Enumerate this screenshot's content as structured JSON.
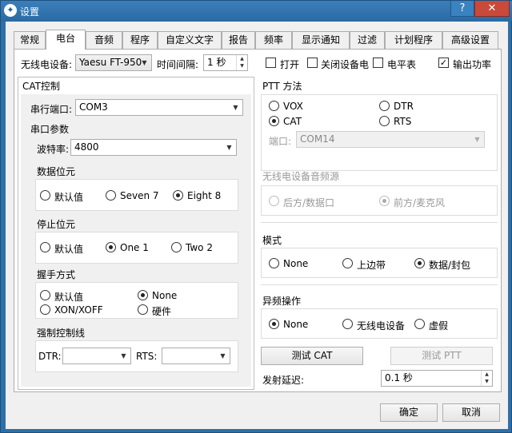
{
  "window": {
    "title": "设置",
    "help": "?",
    "close": "✕"
  },
  "tabs": [
    {
      "label": "常规"
    },
    {
      "label": "电台"
    },
    {
      "label": "音频"
    },
    {
      "label": "程序"
    },
    {
      "label": "自定义文字"
    },
    {
      "label": "报告"
    },
    {
      "label": "频率"
    },
    {
      "label": "显示通知"
    },
    {
      "label": "过滤"
    },
    {
      "label": "计划程序"
    },
    {
      "label": "高级设置"
    }
  ],
  "top": {
    "radio_label": "无线电设备:",
    "radio_value": "Yaesu FT-950",
    "interval_label": "时间间隔:",
    "interval_value": "1 秒",
    "open_label": "打开",
    "close_device_label": "关闭设备电",
    "meter_label": "电平表",
    "output_power_label": "输出功率",
    "output_power_checked": "✓"
  },
  "cat": {
    "title": "CAT控制",
    "port_label": "串行端口:",
    "port_value": "COM3",
    "serial_params": "串口参数",
    "baud_label": "波特率:",
    "baud_value": "4800",
    "databits_title": "数据位元",
    "databits": [
      "默认值",
      "Seven 7",
      "Eight 8"
    ],
    "stopbits_title": "停止位元",
    "stopbits": [
      "默认值",
      "One 1",
      "Two 2"
    ],
    "handshake_title": "握手方式",
    "handshake": [
      "默认值",
      "None",
      "XON/XOFF",
      "硬件"
    ],
    "force_title": "强制控制线",
    "dtr_label": "DTR:",
    "rts_label": "RTS:"
  },
  "ptt": {
    "title": "PTT 方法",
    "options": [
      "VOX",
      "DTR",
      "CAT",
      "RTS"
    ],
    "port_label": "端口:",
    "port_value": "COM14"
  },
  "audio_src": {
    "title": "无线电设备音频源",
    "options": [
      "后方/数据口",
      "前方/麦克风"
    ]
  },
  "mode": {
    "title": "模式",
    "options": [
      "None",
      "上边带",
      "数据/封包"
    ]
  },
  "split": {
    "title": "异频操作",
    "options": [
      "None",
      "无线电设备",
      "虚假"
    ]
  },
  "buttons": {
    "test_cat": "测试 CAT",
    "test_ptt": "测试 PTT",
    "ok": "确定",
    "cancel": "取消"
  },
  "tx_delay": {
    "label": "发射延迟:",
    "value": "0.1 秒"
  },
  "icons": {
    "dropdown": "▼",
    "up": "▲",
    "down": "▼"
  }
}
